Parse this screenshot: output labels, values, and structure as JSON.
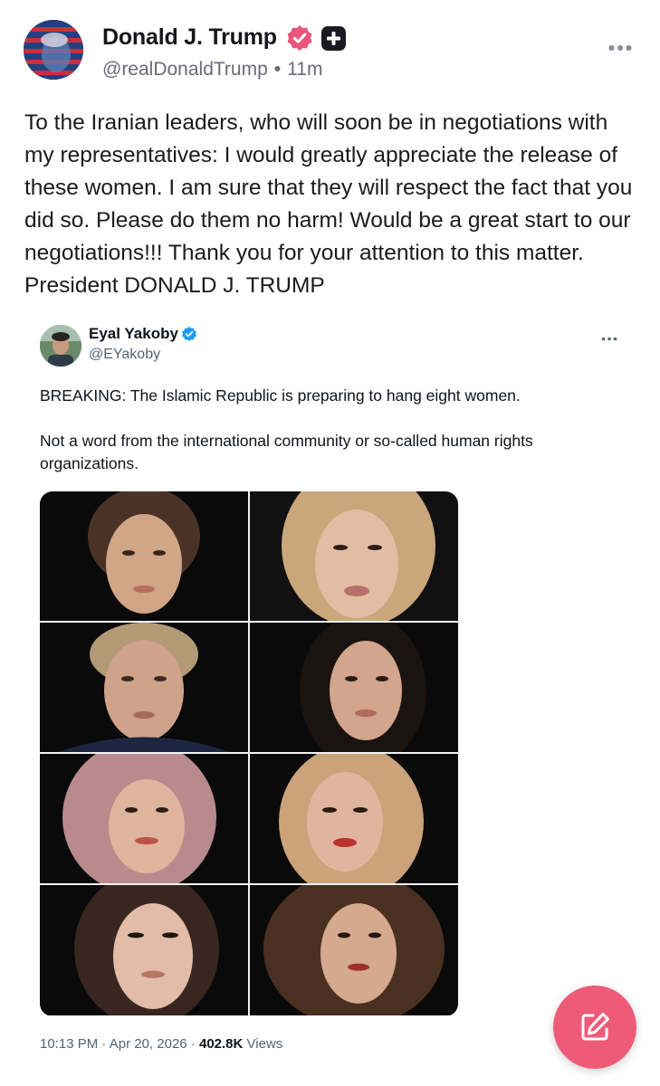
{
  "post": {
    "author_name": "Donald J. Trump",
    "handle": "@realDonaldTrump",
    "time": "11m",
    "text": "To the Iranian leaders, who will soon be in negotiations with my representatives: I would greatly appreciate the release of these women. I am sure that they will respect the fact that you did so. Please do them no harm! Would be a great start to our negotiations!!! Thank you for your attention to this matter. President DONALD J. TRUMP",
    "more_icon": "ellipsis-icon",
    "verified_icon": "verified-badge-icon",
    "plus_icon": "plus-badge-icon"
  },
  "embedded": {
    "author_name": "Eyal Yakoby",
    "handle": "@EYakoby",
    "text_line1": "BREAKING: The Islamic Republic is preparing to hang eight women.",
    "text_line2": "Not a word from the international community or so-called human rights organizations.",
    "time": "10:13 PM",
    "date": "Apr 20, 2026",
    "views_count": "402.8K",
    "views_label": "Views",
    "photo_count": 8
  },
  "compose_button": {
    "icon": "compose-icon"
  },
  "colors": {
    "accent": "#ee5b78",
    "verified_trump": "#e8577a",
    "verified_x": "#1d9bf0",
    "text_primary": "#1b1b1f",
    "text_secondary": "#6b6b78"
  }
}
